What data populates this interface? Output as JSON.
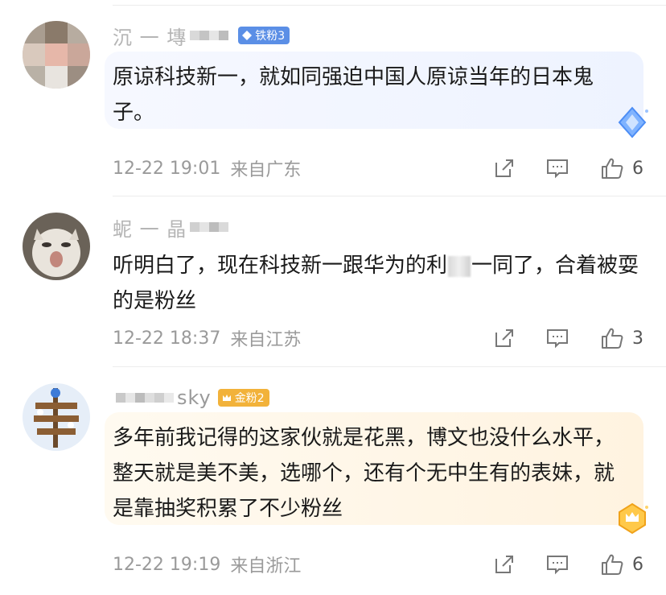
{
  "comments": [
    {
      "name": "沉 一 塼",
      "badge": "铁粉3",
      "badge_color": "#5b8fe6",
      "text": "原谅科技新一，就如同强迫中国人原谅当年的日本鬼子。",
      "time": "12-22 19:01",
      "location": "来自广东",
      "likes": "6"
    },
    {
      "name": "蚭 一 晶",
      "badge": "",
      "text_a": "听明白了，现在科技新一跟华为的利",
      "text_b": "一同了，合着被耍的是粉丝",
      "time": "12-22 18:37",
      "location": "来自江苏",
      "likes": "3"
    },
    {
      "name": "sky",
      "badge": "金粉2",
      "badge_color": "#f2b23a",
      "text": "多年前我记得的这家伙就是花黑，博文也没什么水平，整天就是美不美，选哪个，还有个无中生有的表妹，就是靠抽奖积累了不少粉丝",
      "time": "12-22 19:19",
      "location": "来自浙江",
      "likes": "6"
    }
  ],
  "icons": {
    "share": "share-icon",
    "comment": "comment-icon",
    "like": "thumbs-up-icon"
  }
}
